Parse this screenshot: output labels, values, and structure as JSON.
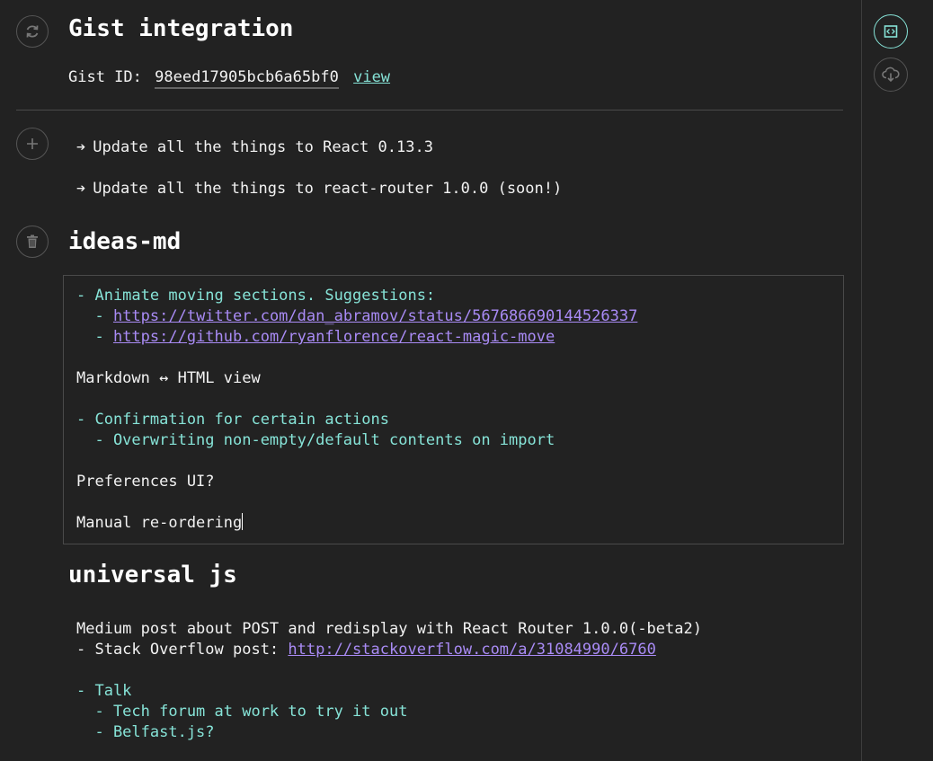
{
  "gist": {
    "title": "Gist integration",
    "id_label": "Gist ID:",
    "id_value": "98eed17905bcb6a65bf0",
    "view_label": "view"
  },
  "todos": [
    "Update all the things to React 0.13.3",
    "Update all the things to react-router 1.0.0 (soon!)"
  ],
  "todo_arrow": "➔",
  "ideas": {
    "title": "ideas-md",
    "lines": {
      "l1": "- Animate moving sections. Suggestions:",
      "l2_prefix": "  - ",
      "l2_link": "https://twitter.com/dan_abramov/status/567686690144526337",
      "l3_prefix": "  - ",
      "l3_link": "https://github.com/ryanflorence/react-magic-move",
      "l4": "Markdown ↔ HTML view",
      "l5": "- Confirmation for certain actions",
      "l6": "  - Overwriting non-empty/default contents on import",
      "l7": "Preferences UI?",
      "l8": "Manual re-ordering"
    }
  },
  "universal": {
    "title": "universal js",
    "lines": {
      "l1": "Medium post about POST and redisplay with React Router 1.0.0(-beta2)",
      "l2_prefix": "- Stack Overflow post: ",
      "l2_link": "http://stackoverflow.com/a/31084990/6760",
      "l3": "- Talk",
      "l4": "  - Tech forum at work to try it out",
      "l5": "  - Belfast.js?"
    }
  },
  "icons": {
    "refresh": "refresh-icon",
    "add": "plus-icon",
    "delete": "trash-icon",
    "toggle_view": "code-view-icon",
    "cloud": "cloud-download-icon"
  },
  "colors": {
    "background": "#222222",
    "accent": "#86e3d7",
    "link": "#a98bf5",
    "text": "#f2f2f2",
    "border": "#4a4a4a"
  }
}
